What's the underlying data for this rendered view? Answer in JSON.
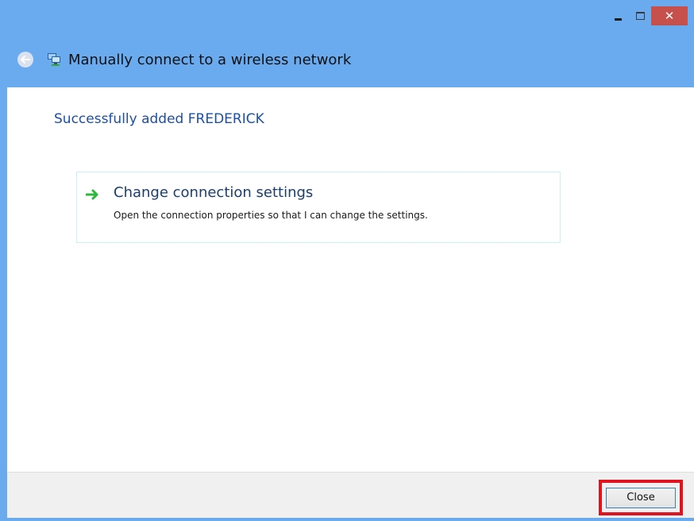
{
  "window": {
    "title": "Manually connect to a wireless network",
    "controls": {
      "minimize_icon": "minimize-icon",
      "maximize_icon": "maximize-icon",
      "close_glyph": "✕"
    }
  },
  "content": {
    "heading": "Successfully added FREDERICK",
    "option": {
      "title": "Change connection settings",
      "description": "Open the connection properties so that I can change the settings.",
      "icon": "green-arrow-icon"
    }
  },
  "footer": {
    "close_label": "Close"
  },
  "colors": {
    "titlebar": "#6aabf0",
    "close_button_bg": "#c7504c",
    "heading_text": "#1e4fa6",
    "highlight": "#e0141e",
    "arrow": "#2db83d"
  }
}
